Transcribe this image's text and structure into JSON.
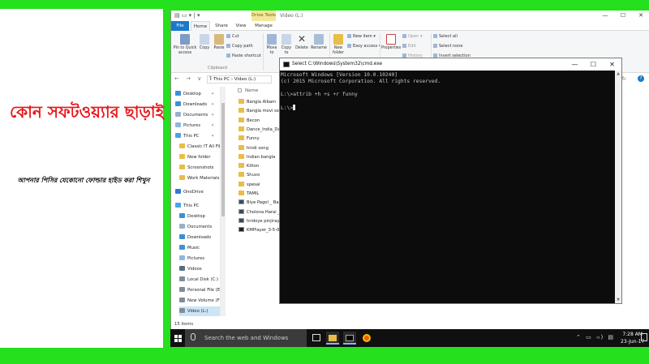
{
  "card": {
    "headline": "কোন সফটওয়্যার ছাড়াই",
    "subline": "আপনার পিসির যেকোনো ফোল্ডার হাইড করা শিখুন"
  },
  "explorer": {
    "title_context": "Drive Tools",
    "title_path": "Video (L:)",
    "window_buttons": [
      "—",
      "☐",
      "✕"
    ],
    "tabs": [
      "File",
      "Home",
      "Share",
      "View",
      "Manage"
    ],
    "ribbon": {
      "pin": "Pin to Quick access",
      "copy": "Copy",
      "paste": "Paste",
      "cut": "Cut",
      "copy_path": "Copy path",
      "paste_shortcut": "Paste shortcut",
      "clipboard_group": "Clipboard",
      "move_to": "Move to",
      "copy_to": "Copy to",
      "delete": "Delete",
      "rename": "Rename",
      "new_folder": "New folder",
      "new_item": "New item",
      "easy_access": "Easy access",
      "properties": "Properties",
      "open": "Open",
      "edit": "Edit",
      "history": "History",
      "select_all": "Select all",
      "select_none": "Select none",
      "invert_selection": "Invert selection"
    },
    "address": {
      "nav_arrows": "← → ∨ ↑",
      "path": "› This PC › Video (L:)",
      "refresh": "↻"
    },
    "nav_pane": [
      {
        "label": "Desktop",
        "icon": "desktop-icon",
        "color": "#3d8fd6",
        "pinned": true
      },
      {
        "label": "Downloads",
        "icon": "downloads-icon",
        "color": "#3d8fd6",
        "pinned": true
      },
      {
        "label": "Documents",
        "icon": "documents-icon",
        "color": "#9ab0c8",
        "pinned": true
      },
      {
        "label": "Pictures",
        "icon": "pictures-icon",
        "color": "#8fb7e0",
        "pinned": true
      },
      {
        "label": "This PC",
        "icon": "computer-icon",
        "color": "#4aa3e6",
        "pinned": true
      },
      {
        "label": "Classic IT All File",
        "icon": "folder-icon",
        "color": "#e8bd48"
      },
      {
        "label": "New folder",
        "icon": "folder-icon",
        "color": "#e8bd48"
      },
      {
        "label": "Screenshots",
        "icon": "folder-icon",
        "color": "#e8bd48"
      },
      {
        "label": "Work Materials",
        "icon": "folder-icon",
        "color": "#e8bd48"
      },
      {
        "label": "OneDrive",
        "icon": "cloud-icon",
        "color": "#2f7ad6"
      },
      {
        "label": "This PC",
        "icon": "computer-icon",
        "color": "#4aa3e6"
      },
      {
        "label": "Desktop",
        "icon": "desktop-icon",
        "color": "#3d8fd6"
      },
      {
        "label": "Documents",
        "icon": "documents-icon",
        "color": "#9ab0c8"
      },
      {
        "label": "Downloads",
        "icon": "downloads-icon",
        "color": "#3d8fd6"
      },
      {
        "label": "Music",
        "icon": "music-icon",
        "color": "#3d8fd6"
      },
      {
        "label": "Pictures",
        "icon": "pictures-icon",
        "color": "#8fb7e0"
      },
      {
        "label": "Videos",
        "icon": "videos-icon",
        "color": "#5b6c80"
      },
      {
        "label": "Local Disk (C:)",
        "icon": "drive-icon",
        "color": "#7f8c99"
      },
      {
        "label": "Personal File (E:)",
        "icon": "drive-icon",
        "color": "#7f8c99"
      },
      {
        "label": "New Volume (F:)",
        "icon": "drive-icon",
        "color": "#7f8c99"
      },
      {
        "label": "Video (L:)",
        "icon": "drive-icon",
        "color": "#7f8c99",
        "selected": true
      }
    ],
    "column_name": "Name",
    "files": [
      {
        "name": "Bangla Albam",
        "type": "folder"
      },
      {
        "name": "Bangla movi song",
        "type": "folder"
      },
      {
        "name": "Becon",
        "type": "folder"
      },
      {
        "name": "Dance_India_Danc",
        "type": "folder"
      },
      {
        "name": "Funny",
        "type": "folder"
      },
      {
        "name": "hindi song",
        "type": "folder"
      },
      {
        "name": "Indian bangla",
        "type": "folder"
      },
      {
        "name": "Kitton",
        "type": "folder"
      },
      {
        "name": "Shuvo",
        "type": "folder"
      },
      {
        "name": "spesal",
        "type": "folder"
      },
      {
        "name": "TAMIL",
        "type": "folder"
      },
      {
        "name": "Biye Pagol _ Bangla",
        "type": "video"
      },
      {
        "name": "Cholona Harai _ Ta",
        "type": "video"
      },
      {
        "name": "hridoye pinjiray po",
        "type": "video"
      },
      {
        "name": "KMPlayer_3-5-0-77",
        "type": "app"
      }
    ],
    "status": "15 items"
  },
  "cmd": {
    "title": "Select C:\\Windows\\System32\\cmd.exe",
    "lines": [
      "Microsoft Windows [Version 10.0.10240]",
      "(c) 2015 Microsoft Corporation. All rights reserved.",
      "",
      "L:\\>attrib +h +s +r funny",
      "",
      "L:\\>"
    ],
    "buttons": [
      "—",
      "☐",
      "✕"
    ]
  },
  "taskbar": {
    "search_placeholder": "Search the web and Windows",
    "tray": "⌃ ▭ ◃) ▤",
    "time": "7:28 AM",
    "date": "23-Jun-17"
  }
}
